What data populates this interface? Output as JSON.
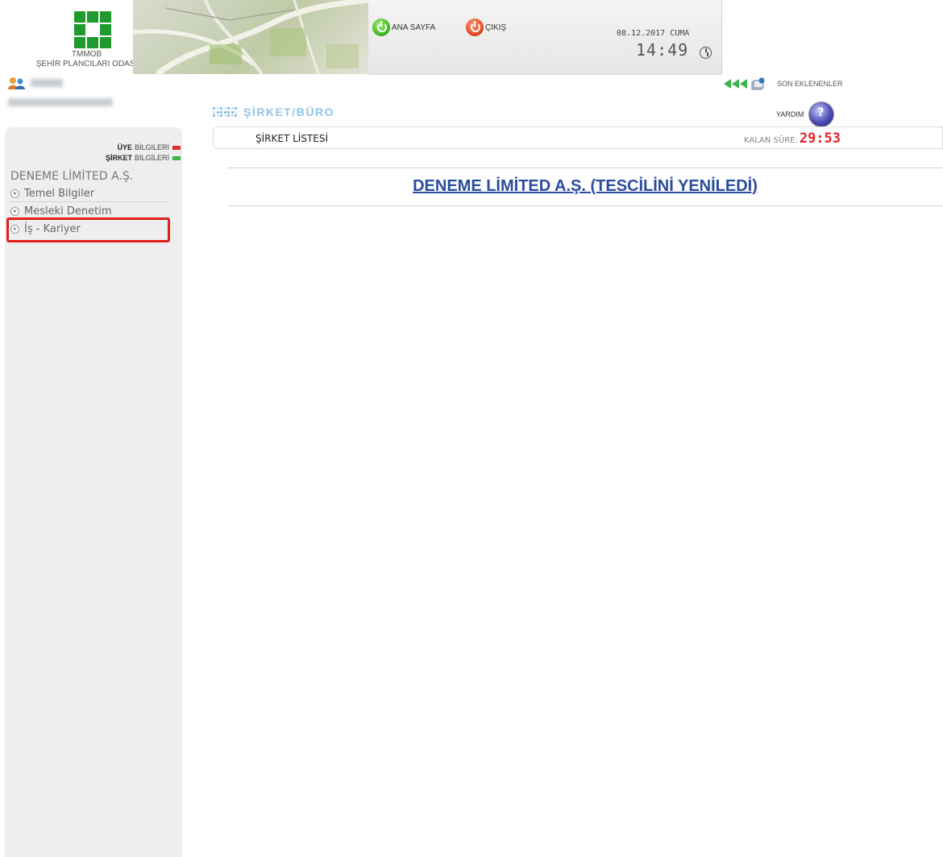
{
  "header": {
    "org_line1": "TMMOB",
    "org_line2": "ŞEHİR PLANCILARI ODASI",
    "home_label": "ANA SAYFA",
    "logout_label": "ÇIKIŞ",
    "date": "08.12.2017 CUMA",
    "time": "14:49"
  },
  "user": {
    "icon": "users-icon"
  },
  "sidebar": {
    "uye_bold": "ÜYE",
    "uye_rest": "BİLGİLERİ",
    "sirket_bold": "ŞİRKET",
    "sirket_rest": "BİLGİLERİ",
    "company": "DENEME LİMİTED A.Ş.",
    "items": [
      {
        "label": "Temel Bilgiler"
      },
      {
        "label": "Mesleki Denetim"
      },
      {
        "label": "İş - Kariyer"
      }
    ],
    "colors": {
      "uye": "#d9302c",
      "sirket": "#3ab54a",
      "highlight": "#e0201a"
    }
  },
  "content": {
    "section_title": "ŞİRKET/BÜRO",
    "son_eklenenler": "SON EKLENENLER",
    "yardim": "YARDIM",
    "breadcrumb": "ŞİRKET LİSTESİ",
    "kalan_label": "KALAN SÜRE:",
    "kalan_value": "29:53",
    "company_link": "DENEME LİMİTED A.Ş. (TESCİLİNİ YENİLEDİ)"
  }
}
